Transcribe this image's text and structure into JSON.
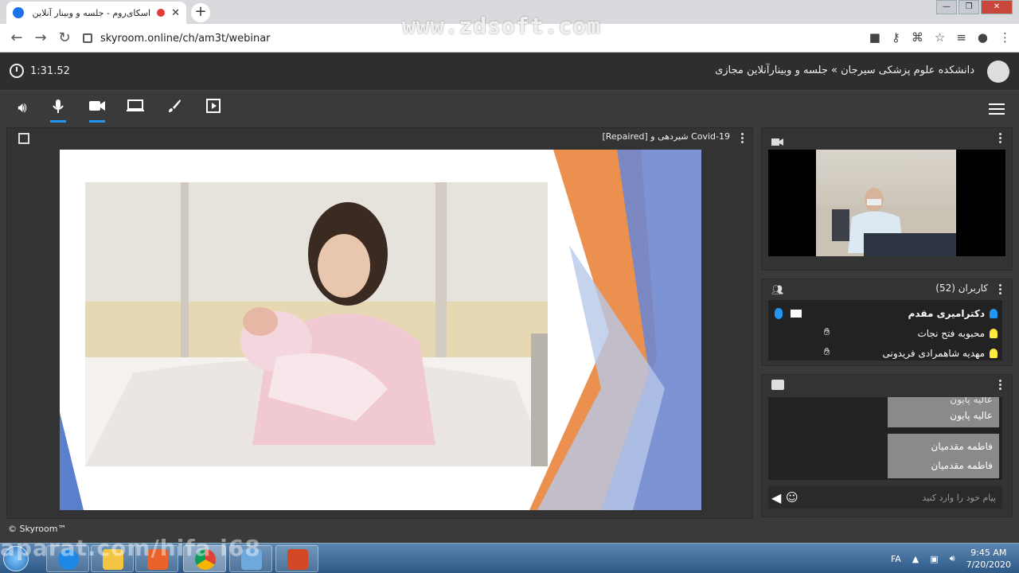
{
  "browser": {
    "tab_title": "اسکای‌روم - جلسه و وبینار آنلاین مجازی",
    "new_tab": "+",
    "tab_close": "✕",
    "url": "skyroom.online/ch/am3t/webinar",
    "watermark": "www.zdsoft.com",
    "nav_back": "←",
    "nav_forward": "→",
    "nav_reload": "↻",
    "win_minimize": "—",
    "win_restore": "❐",
    "win_close": "✕"
  },
  "app": {
    "timer": "1:31.52",
    "room_title": "دانشکده علوم پزشکی سیرجان » جلسه و وبینارآنلاین مجازی"
  },
  "presentation": {
    "title": "Covid-19 شیردهی و [Repaired]"
  },
  "users": {
    "header": "کاربران (52)",
    "list": [
      {
        "name": "دکترامیری مقدم",
        "role": "host",
        "icon_color": "#2196f3"
      },
      {
        "name": "محبوبه فتح نجات",
        "role": "guest",
        "icon_color": "#ffeb3b"
      },
      {
        "name": "مهدیه شاهمرادی فریدونی",
        "role": "guest",
        "icon_color": "#ffeb3b"
      }
    ]
  },
  "chat": {
    "messages": [
      {
        "top": "عالیه پایون",
        "bottom": "عالیه پایون"
      },
      {
        "top": "فاطمه مقدمیان",
        "bottom": "فاطمه مقدمیان"
      }
    ],
    "input_placeholder": "پیام خود را وارد کنید"
  },
  "footer": {
    "brand": "© Skyroom™"
  },
  "taskbar": {
    "language": "FA",
    "time": "9:45 AM",
    "date": "7/20/2020",
    "watermark": "aparat.com/hifa i68"
  }
}
